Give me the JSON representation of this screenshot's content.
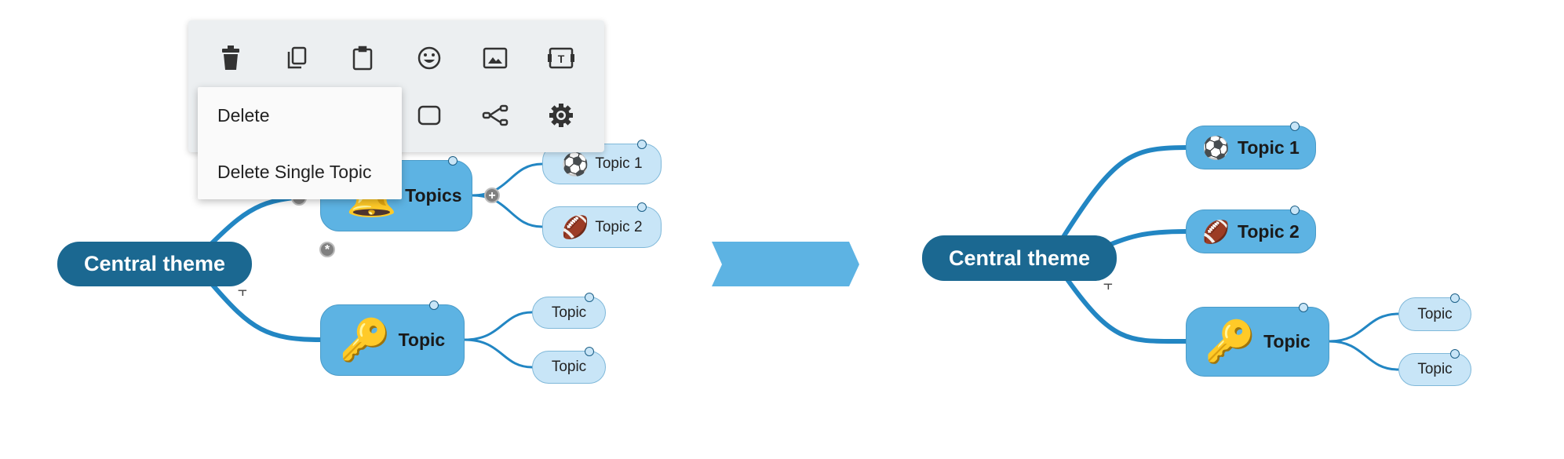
{
  "colors": {
    "central": "#1b6891",
    "main_topic": "#5db3e3",
    "sub_topic": "#c8e5f7",
    "branch": "#2286c3",
    "toolbar": "#eceff1"
  },
  "toolbar": {
    "row1": [
      {
        "icon": "trash-icon"
      },
      {
        "icon": "copy-icon"
      },
      {
        "icon": "clipboard-icon"
      },
      {
        "icon": "emoji-icon"
      },
      {
        "icon": "image-icon"
      },
      {
        "icon": "text-box-icon"
      }
    ],
    "row2": [
      {
        "icon": "rectangle-icon"
      },
      {
        "icon": "tree-share-icon"
      },
      {
        "icon": "gear-icon"
      }
    ]
  },
  "context_menu": {
    "items": [
      "Delete",
      "Delete Single Topic"
    ]
  },
  "before": {
    "central": "Central theme",
    "topics_node": {
      "label": "Topics",
      "icon": "🔔"
    },
    "topic1": {
      "label": "Topic 1",
      "icon": "⚽"
    },
    "topic2": {
      "label": "Topic 2",
      "icon": "🏈"
    },
    "key_topic": {
      "label": "Topic",
      "icon": "🔑"
    },
    "sub1": "Topic",
    "sub2": "Topic",
    "plus": "+",
    "asterisk": "*",
    "fork": "⫟"
  },
  "after": {
    "central": "Central theme",
    "topic1": {
      "label": "Topic 1",
      "icon": "⚽"
    },
    "topic2": {
      "label": "Topic 2",
      "icon": "🏈"
    },
    "key_topic": {
      "label": "Topic",
      "icon": "🔑"
    },
    "sub1": "Topic",
    "sub2": "Topic",
    "fork": "⫟"
  }
}
